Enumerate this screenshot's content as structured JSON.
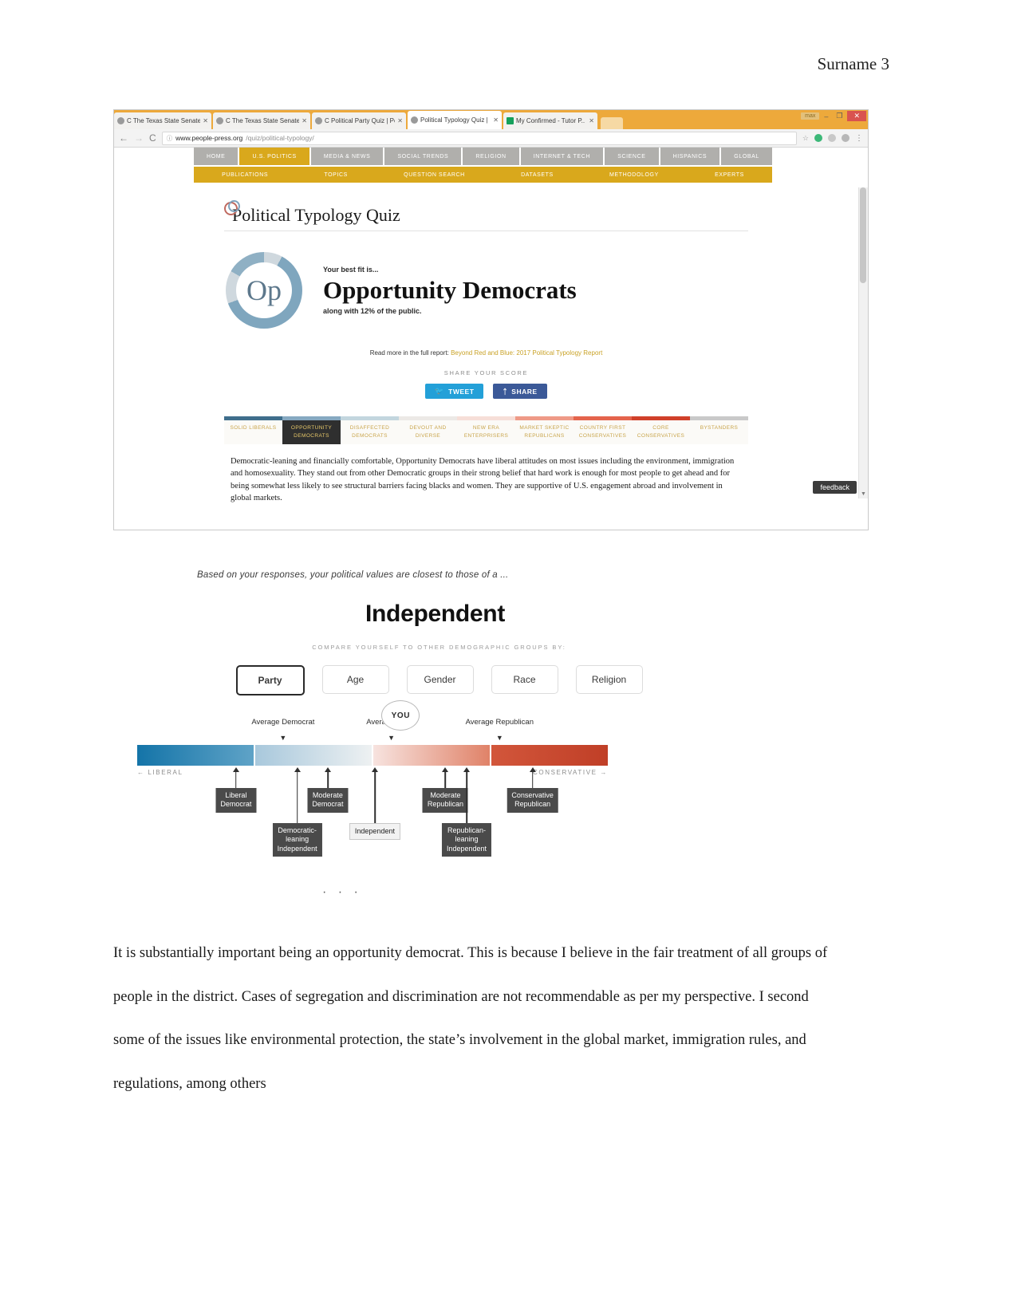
{
  "page": {
    "header": "Surname 3"
  },
  "browser": {
    "tabs": [
      {
        "title": "C The Texas State Senate",
        "favicon": "globe-icon",
        "active": false
      },
      {
        "title": "C The Texas State Senate",
        "favicon": "globe-icon",
        "active": false
      },
      {
        "title": "C Political Party Quiz | Pe",
        "favicon": "globe-icon",
        "active": false
      },
      {
        "title": "Political Typology Quiz |",
        "favicon": "globe-icon",
        "active": true
      },
      {
        "title": "My Confirmed - Tutor P..",
        "favicon": "note-icon",
        "active": false
      }
    ],
    "tab_close_glyph": "✕",
    "new_tab_label": "",
    "window_controls": {
      "max_badge": "max",
      "minimize": "–",
      "restore": "❐",
      "close": "✕"
    },
    "nav": {
      "back": "←",
      "forward": "→",
      "reload": "C"
    },
    "url": {
      "info_icon": "info-icon",
      "domain": "www.people-press.org",
      "path": "/quiz/political-typology/"
    },
    "toolbar": {
      "star": "☆",
      "kebab": "⋮"
    }
  },
  "site": {
    "nav": [
      "HOME",
      "U.S. POLITICS",
      "MEDIA & NEWS",
      "SOCIAL TRENDS",
      "RELIGION",
      "INTERNET & TECH",
      "SCIENCE",
      "HISPANICS",
      "GLOBAL"
    ],
    "nav_active": "U.S. POLITICS",
    "subnav": [
      "PUBLICATIONS",
      "TOPICS",
      "QUESTION SEARCH",
      "DATASETS",
      "METHODOLOGY",
      "EXPERTS"
    ],
    "quiz_title": "Political Typology Quiz",
    "result": {
      "donut_label": "Op",
      "best_fit_label": "Your best fit is...",
      "group_name": "Opportunity Democrats",
      "along_with": "along with 12% of the public.",
      "public_percent": "12%"
    },
    "read_more_prefix": "Read more in the full report:",
    "read_more_link": "Beyond Red and Blue: 2017 Political Typology Report",
    "share_heading": "SHARE YOUR SCORE",
    "share_buttons": [
      {
        "label": "TWEET",
        "icon": "twitter-icon",
        "color": "#23a0d8"
      },
      {
        "label": "SHARE",
        "icon": "facebook-icon",
        "color": "#3b5998"
      }
    ],
    "typology": {
      "tabs": [
        {
          "label": "SOLID LIBERALS",
          "color": "#3f6e8c",
          "selected": false
        },
        {
          "label": "OPPORTUNITY DEMOCRATS",
          "color": "#86a9c1",
          "selected": true
        },
        {
          "label": "DISAFFECTED DEMOCRATS",
          "color": "#c3d6de",
          "selected": false
        },
        {
          "label": "DEVOUT AND DIVERSE",
          "color": "#ece9e6",
          "selected": false
        },
        {
          "label": "NEW ERA ENTERPRISERS",
          "color": "#f6ded8",
          "selected": false
        },
        {
          "label": "MARKET SKEPTIC REPUBLICANS",
          "color": "#ef9a87",
          "selected": false
        },
        {
          "label": "COUNTRY FIRST CONSERVATIVES",
          "color": "#e4644c",
          "selected": false
        },
        {
          "label": "CORE CONSERVATIVES",
          "color": "#d0402a",
          "selected": false
        },
        {
          "label": "BYSTANDERS",
          "color": "#c9c9c9",
          "selected": false
        }
      ],
      "description": "Democratic-leaning and financially comfortable, Opportunity Democrats have liberal attitudes on most issues including the environment, immigration and homosexuality. They stand out from other Democratic groups in their strong belief that hard work is enough for most people to get ahead and for being somewhat less likely to see structural barriers facing blacks and women. They are supportive of U.S. engagement abroad and involvement in global markets."
    },
    "feedback_label": "feedback"
  },
  "chart_data": {
    "type": "scatter",
    "title": "Independent",
    "kicker": "Based on your responses, your political values are closest to those of a ...",
    "compare_label": "COMPARE YOURSELF TO OTHER DEMOGRAPHIC GROUPS BY:",
    "demographic_tabs": [
      {
        "label": "Party",
        "selected": true
      },
      {
        "label": "Age",
        "selected": false
      },
      {
        "label": "Gender",
        "selected": false
      },
      {
        "label": "Race",
        "selected": false
      },
      {
        "label": "Religion",
        "selected": false
      }
    ],
    "xlabel": "",
    "ylabel": "",
    "axis_left_label": "← LIBERAL",
    "axis_right_label": "CONSERVATIVE →",
    "xlim": [
      0,
      100
    ],
    "average_markers": [
      {
        "label": "Average Democrat",
        "x": 31
      },
      {
        "label": "Average Score",
        "x": 54
      },
      {
        "label": "Average Republican",
        "x": 77
      }
    ],
    "you_marker": {
      "label": "YOU",
      "x": 54
    },
    "group_points": [
      {
        "label": "Liberal Democrat",
        "x": 21
      },
      {
        "label": "Democratic-leaning Independent",
        "x": 34
      },
      {
        "label": "Moderate Democrat",
        "x": 40
      },
      {
        "label": "Independent",
        "x": 49
      },
      {
        "label": "Moderate Republican",
        "x": 66
      },
      {
        "label": "Republican-leaning Independent",
        "x": 70
      },
      {
        "label": "Conservative Republican",
        "x": 83
      }
    ],
    "scale_segments": [
      {
        "from": 0,
        "to": 25,
        "color_start": "#1474a8",
        "color_end": "#5fa3c7"
      },
      {
        "from": 25,
        "to": 50,
        "color_start": "#a8c8dc",
        "color_end": "#eef1f2"
      },
      {
        "from": 50,
        "to": 75,
        "color_start": "#f7e3df",
        "color_end": "#e08268"
      },
      {
        "from": 75,
        "to": 100,
        "color_start": "#d2563b",
        "color_end": "#c03f27"
      }
    ],
    "ellipsis": "· · ·"
  },
  "essay": {
    "paragraph": "It is substantially important being an opportunity democrat. This is because I believe in the fair treatment of all groups of people in the district. Cases of segregation and discrimination are not recommendable as per my perspective. I second some of the issues like environmental protection, the state’s involvement in the global market, immigration rules, and regulations, among others"
  }
}
